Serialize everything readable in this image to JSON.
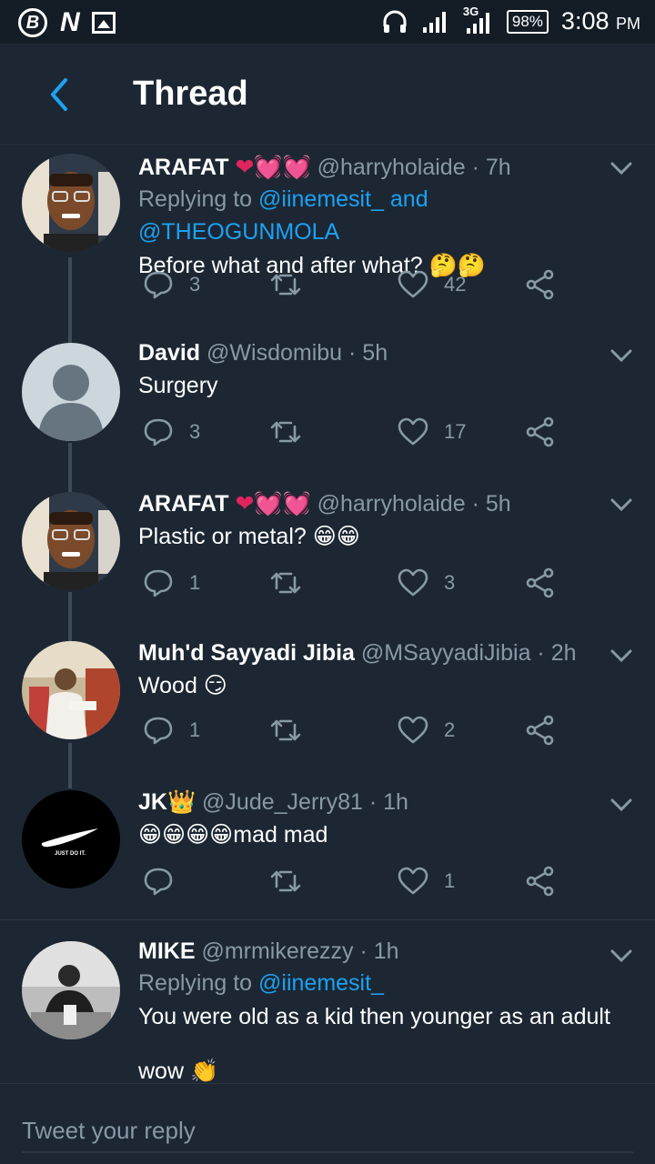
{
  "statusbar": {
    "left_icons": [
      "b-badge-icon",
      "n-app-icon",
      "gallery-icon"
    ],
    "b_label": "B",
    "n_label": "N",
    "network": "3G",
    "battery": "98%",
    "time": "3:08",
    "ampm": "PM"
  },
  "header": {
    "title": "Thread"
  },
  "tweets": [
    {
      "name": "ARAFAT",
      "handle": "@harryholaide",
      "time": "· 7h",
      "replying_label": "Replying to",
      "replying_to": "@iinemesit_ and @THEOGUNMOLA",
      "text": "Before what and after what? 🤔🤔",
      "replies": "3",
      "retweets": "",
      "likes": "42"
    },
    {
      "name": "David",
      "handle": "@Wisdomibu",
      "time": "· 5h",
      "text": "Surgery",
      "replies": "3",
      "retweets": "",
      "likes": "17"
    },
    {
      "name": "ARAFAT",
      "handle": "@harryholaide",
      "time": "· 5h",
      "text": "Plastic or metal? 😁😁",
      "replies": "1",
      "retweets": "",
      "likes": "3"
    },
    {
      "name": "Muh'd Sayyadi Jibia",
      "handle": "@MSayyadiJibia",
      "time": "· 2h",
      "text": "Wood 😏",
      "replies": "1",
      "retweets": "",
      "likes": "2"
    },
    {
      "name": "JK👑",
      "handle": "@Jude_Jerry81",
      "time": "· 1h",
      "text": "😁😁😁😁mad mad",
      "replies": "",
      "retweets": "",
      "likes": "1"
    },
    {
      "name": "MIKE",
      "handle": "@mrmikerezzy",
      "time": "· 1h",
      "replying_label": "Replying to",
      "replying_to": "@iinemesit_",
      "text": "You were old as a kid then younger as an adult",
      "text2": "wow 👏"
    }
  ],
  "reply_bar": {
    "placeholder": "Tweet your reply"
  },
  "colors": {
    "background": "#1c2733",
    "accent": "#1da1f2",
    "muted": "#8899a6",
    "heart_pink": "#e0245e"
  }
}
